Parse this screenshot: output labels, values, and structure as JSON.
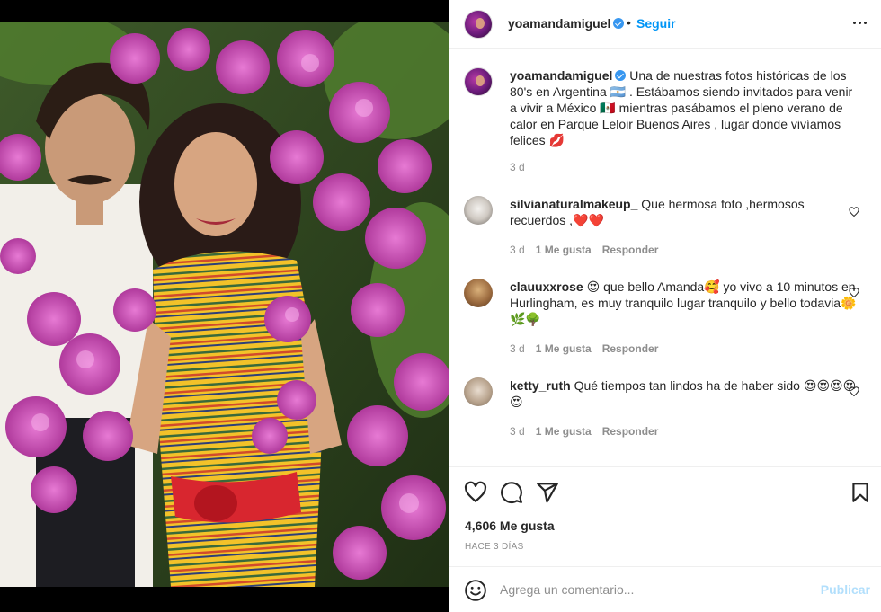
{
  "post": {
    "username": "yoamandamiguel",
    "follow_label": "Seguir",
    "dot": "•"
  },
  "caption": {
    "username": "yoamandamiguel",
    "text": "Una de nuestras fotos históricas de los 80's en Argentina 🇦🇷 . Estábamos siendo invitados para venir a vivir a México 🇲🇽 mientras pasábamos el pleno verano de calor en Parque Leloir Buenos Aires , lugar donde vivíamos felices 💋",
    "age": "3 d"
  },
  "comments": [
    {
      "username": "silvianaturalmakeup_",
      "text": "Que hermosa foto ,hermosos recuerdos ,❤️❤️",
      "age": "3 d",
      "likes": "1 Me gusta",
      "reply": "Responder"
    },
    {
      "username": "clauuxxrose",
      "text": "😍 que bello Amanda🥰 yo vivo a 10 minutos en Hurlingham, es muy tranquilo lugar tranquilo y bello todavia🌼🌿🌳",
      "age": "3 d",
      "likes": "1 Me gusta",
      "reply": "Responder"
    },
    {
      "username": "ketty_ruth",
      "text": "Qué tiempos tan lindos ha de haber sido 😍😍😍😍😍",
      "age": "3 d",
      "likes": "1 Me gusta",
      "reply": "Responder"
    }
  ],
  "stats": {
    "likes": "4,606 Me gusta",
    "time": "HACE 3 DÍAS"
  },
  "comment_box": {
    "placeholder": "Agrega un comentario...",
    "publish_label": "Publicar"
  },
  "colors": {
    "accent": "#0095f6",
    "publish_disabled": "#b2dffc",
    "muted": "#8e8e8e",
    "text": "#262626"
  }
}
